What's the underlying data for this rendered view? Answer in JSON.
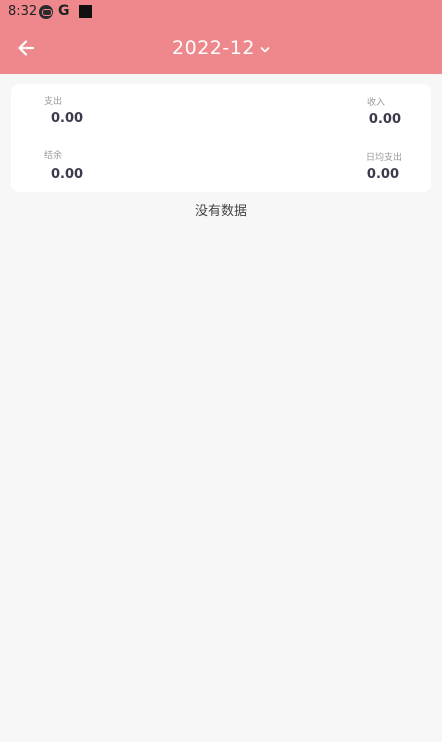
{
  "status_bar": {
    "time": "8:32",
    "icons": [
      "app-notification-icon",
      "google-icon",
      "black-square-icon"
    ],
    "google_glyph": "G"
  },
  "app_bar": {
    "back_icon": "arrow-left-icon",
    "month": "2022-12",
    "dropdown_icon": "chevron-down-icon",
    "color": "#ee888c"
  },
  "summary": {
    "expense": {
      "label": "支出",
      "value": "0.00"
    },
    "income": {
      "label": "收入",
      "value": "0.00"
    },
    "balance": {
      "label": "结余",
      "value": "0.00"
    },
    "daily_average": {
      "label": "日均支出",
      "value": "0.00"
    }
  },
  "empty_state": {
    "message": "没有数据"
  }
}
